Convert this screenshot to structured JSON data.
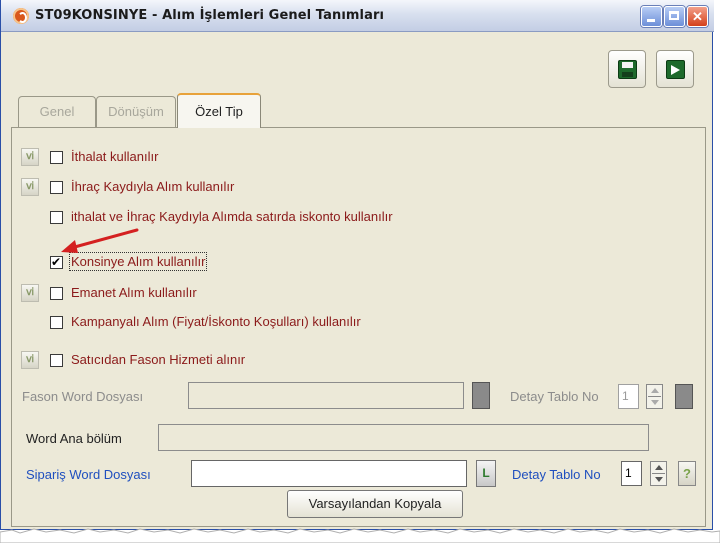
{
  "window": {
    "title": "ST09KONSINYE - Alım İşlemleri Genel Tanımları",
    "icons": {
      "app": "app-logo-icon",
      "minimize": "minimize-icon",
      "maximize": "maximize-icon",
      "close": "close-icon"
    }
  },
  "toolbar": {
    "save_icon": "floppy-disk-icon",
    "exit_icon": "exit-door-icon"
  },
  "tabs": [
    {
      "label": "Genel",
      "active": false
    },
    {
      "label": "Dönüşüm",
      "active": false
    },
    {
      "label": "Özel Tip",
      "active": true
    }
  ],
  "options": [
    {
      "label": "İthalat kullanılır",
      "checked": false,
      "has_icon": true
    },
    {
      "label": "İhraç Kaydıyla Alım kullanılır",
      "checked": false,
      "has_icon": true
    },
    {
      "label": "ithalat ve İhraç Kaydıyla Alımda satırda iskonto kullanılır",
      "checked": false,
      "has_icon": false
    },
    {
      "label": "Konsinye Alım kullanılır",
      "checked": true,
      "has_icon": false
    },
    {
      "label": "Emanet Alım kullanılır",
      "checked": false,
      "has_icon": true
    },
    {
      "label": "Kampanyalı Alım (Fiyat/İskonto Koşulları) kullanılır",
      "checked": false,
      "has_icon": false
    },
    {
      "label": "Satıcıdan Fason Hizmeti alınır",
      "checked": false,
      "has_icon": true
    }
  ],
  "fason": {
    "label": "Fason Word Dosyası",
    "value": "",
    "detail_label": "Detay Tablo No",
    "detail_value": "1"
  },
  "word_ana": {
    "label": "Word Ana bölüm",
    "value": ""
  },
  "siparis": {
    "label": "Sipariş Word Dosyası",
    "value": "",
    "browse_label": "L",
    "detail_label": "Detay Tablo No",
    "detail_value": "1",
    "help_label": "?"
  },
  "copy_button": "Varsayılandan Kopyala",
  "colors": {
    "label_red": "#8b1a1a",
    "label_blue": "#1f4fbf",
    "arrow_red": "#d42020",
    "active_tab_accent": "#e8a23a"
  }
}
